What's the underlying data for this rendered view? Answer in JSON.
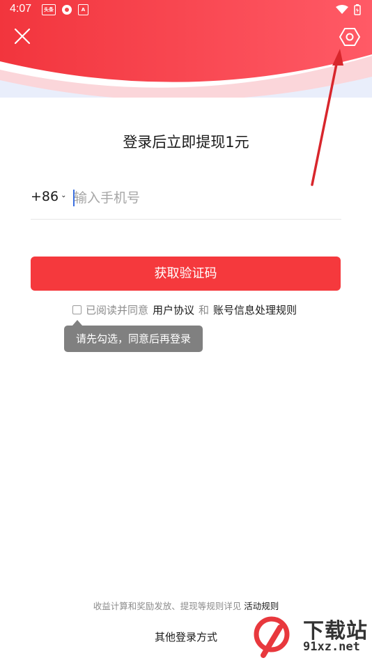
{
  "status_bar": {
    "time": "4:07",
    "app_icons": [
      "头条",
      "",
      "A"
    ]
  },
  "header": {
    "bg_color": "#f2444a",
    "close_icon": "close-icon",
    "settings_icon": "hexagon-settings-icon"
  },
  "title": "登录后立即提现1元",
  "phone": {
    "country_code": "+86",
    "placeholder": "输入手机号",
    "value": ""
  },
  "get_code_button": "获取验证码",
  "agreement": {
    "prefix": "已阅读并同意",
    "user_agreement": "用户协议",
    "and": "和",
    "account_rules": "账号信息处理规则",
    "checked": false
  },
  "tooltip": "请先勾选，同意后再登录",
  "footer": {
    "rules_note": "收益计算和奖励发放、提现等规则详见",
    "rules_link": "活动规则",
    "other_login": "其他登录方式"
  },
  "watermark": {
    "text": "下载站",
    "sub": "91xz.net"
  },
  "colors": {
    "accent": "#f5393d",
    "tooltip": "#808080",
    "muted": "#8c8c8c"
  }
}
